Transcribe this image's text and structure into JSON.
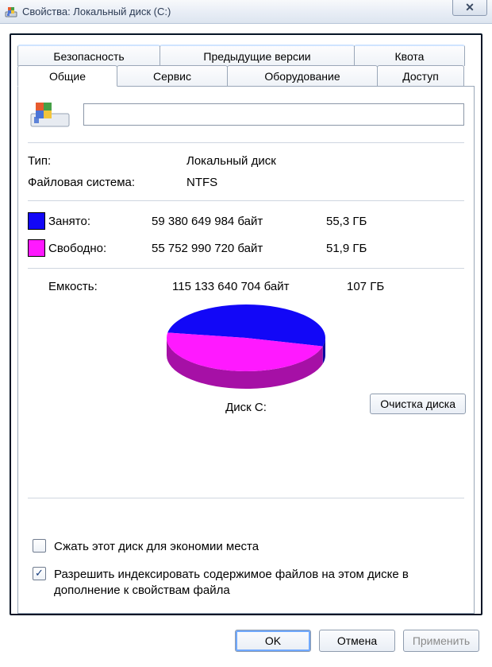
{
  "window": {
    "title": "Свойства: Локальный диск (C:)",
    "close_glyph": "✕"
  },
  "tabs": {
    "top": [
      {
        "id": "security",
        "label": "Безопасность"
      },
      {
        "id": "previous",
        "label": "Предыдущие версии"
      },
      {
        "id": "quota",
        "label": "Квота"
      }
    ],
    "bottom": [
      {
        "id": "general",
        "label": "Общие",
        "active": true
      },
      {
        "id": "tools",
        "label": "Сервис"
      },
      {
        "id": "hardware",
        "label": "Оборудование"
      },
      {
        "id": "sharing",
        "label": "Доступ"
      }
    ]
  },
  "general": {
    "name_value": "",
    "type_label": "Тип:",
    "type_value": "Локальный диск",
    "fs_label": "Файловая система:",
    "fs_value": "NTFS",
    "used": {
      "label": "Занято:",
      "bytes": "59 380 649 984 байт",
      "gb": "55,3 ГБ",
      "color": "#1207f7"
    },
    "free": {
      "label": "Свободно:",
      "bytes": "55 752 990 720 байт",
      "gb": "51,9 ГБ",
      "color": "#ff19ff"
    },
    "capacity": {
      "label": "Емкость:",
      "bytes": "115 133 640 704 байт",
      "gb": "107 ГБ"
    },
    "disk_label": "Диск C:",
    "cleanup_button": "Очистка диска",
    "compress_label": "Сжать этот диск для экономии места",
    "compress_checked": false,
    "index_label": "Разрешить индексировать содержимое файлов на этом диске в дополнение к свойствам файла",
    "index_checked": true
  },
  "buttons": {
    "ok": "OK",
    "cancel": "Отмена",
    "apply": "Применить"
  },
  "chart_data": {
    "type": "pie",
    "title": "Диск C:",
    "series": [
      {
        "name": "Занято",
        "value": 59380649984,
        "color": "#1207f7"
      },
      {
        "name": "Свободно",
        "value": 55752990720,
        "color": "#ff19ff"
      }
    ],
    "total": 115133640704
  }
}
